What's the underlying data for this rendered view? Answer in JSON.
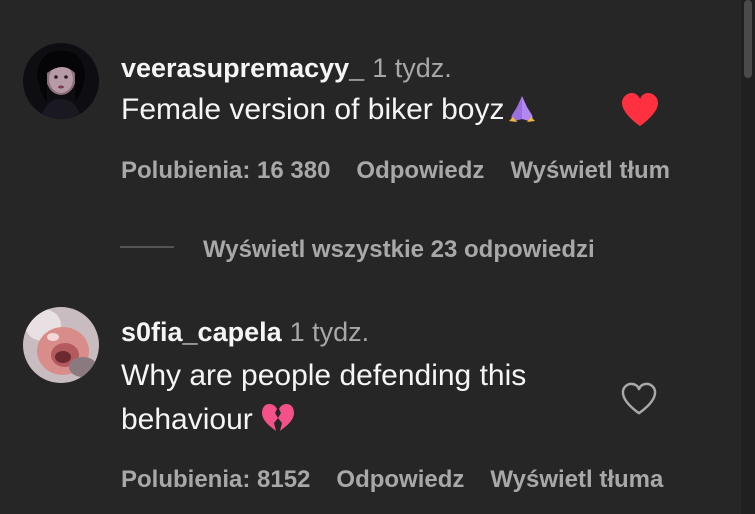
{
  "comments": [
    {
      "username": "veerasupremacyy_",
      "time": "1 tydz.",
      "text": "Female version of biker boyz",
      "emoji": "folded-hands",
      "liked": true,
      "actions": {
        "likes": "Polubienia: 16 380",
        "reply": "Odpowiedz",
        "translate": "Wyświetl tłum"
      },
      "replies_label": "Wyświetl wszystkie 23 odpowiedzi"
    },
    {
      "username": "s0fia_capela",
      "time": "1 tydz.",
      "text_line1": "Why are people defending this",
      "text_line2": "behaviour",
      "emoji": "broken-heart",
      "liked": false,
      "actions": {
        "likes": "Polubienia: 8152",
        "reply": "Odpowiedz",
        "translate": "Wyświetl tłuma"
      }
    }
  ],
  "colors": {
    "background": "#262626",
    "text": "#f5f5f5",
    "secondary": "#a8a8a8",
    "like_red": "#ff3040"
  }
}
